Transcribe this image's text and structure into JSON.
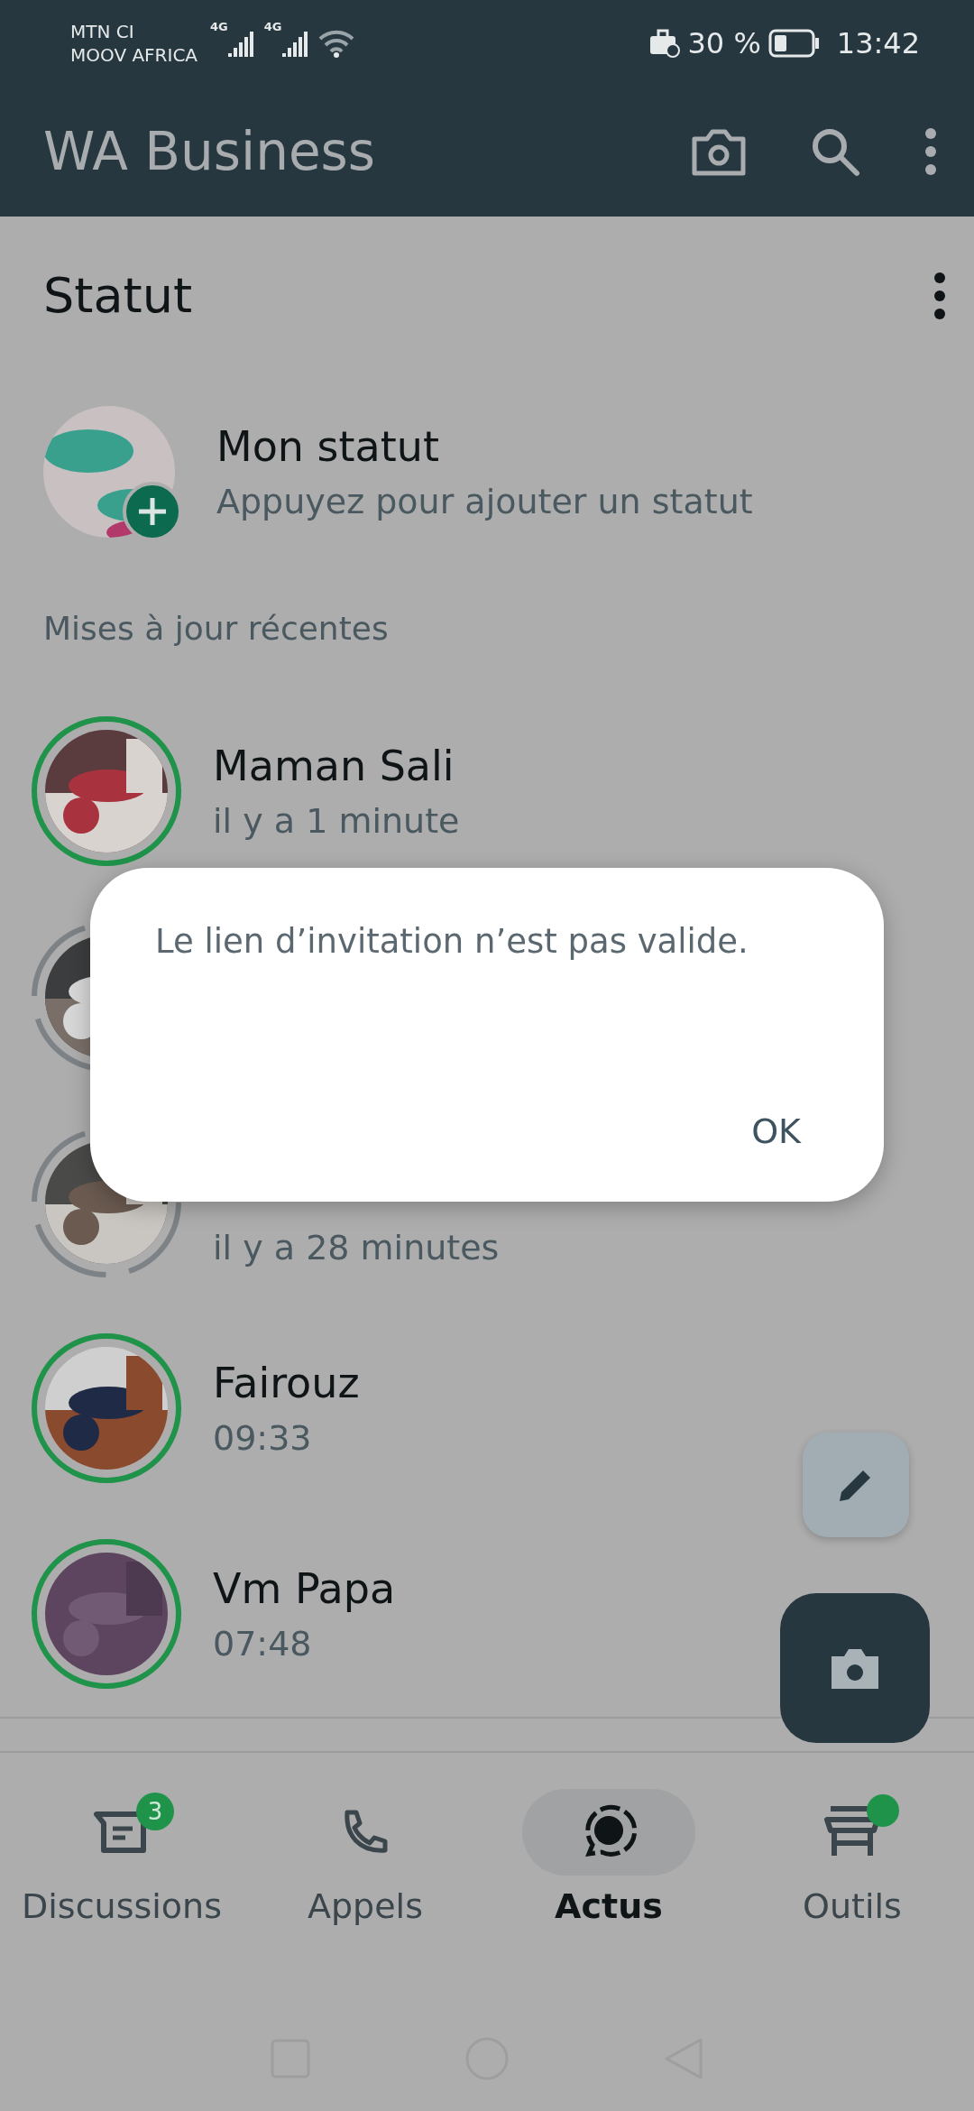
{
  "status_bar": {
    "carriers": [
      "MTN CI",
      "MOOV AFRICA"
    ],
    "network": [
      "4G",
      "4G"
    ],
    "battery": "30 %",
    "time": "13:42"
  },
  "app_bar": {
    "title": "WA Business"
  },
  "section": {
    "title": "Statut"
  },
  "my_status": {
    "name": "Mon statut",
    "hint": "Appuyez pour ajouter un statut"
  },
  "recent_header": "Mises à jour récentes",
  "updates": [
    {
      "name": "Maman Sali",
      "time": "il y a 1 minute",
      "seen": false
    },
    {
      "seen": true
    },
    {
      "time": "il y a 28 minutes",
      "seen": true
    },
    {
      "name": "Fairouz",
      "time": "09:33",
      "seen": false
    },
    {
      "name": "Vm Papa",
      "time": "07:48",
      "seen": false
    }
  ],
  "nav": [
    {
      "label": "Discussions",
      "kind": "chat",
      "badge": "3",
      "selected": false
    },
    {
      "label": "Appels",
      "kind": "phone",
      "selected": false
    },
    {
      "label": "Actus",
      "kind": "status",
      "selected": true
    },
    {
      "label": "Outils",
      "kind": "store",
      "dot": true,
      "selected": false
    }
  ],
  "dialog": {
    "message": "Le lien d’invitation n’est pas valide.",
    "button": "OK"
  }
}
